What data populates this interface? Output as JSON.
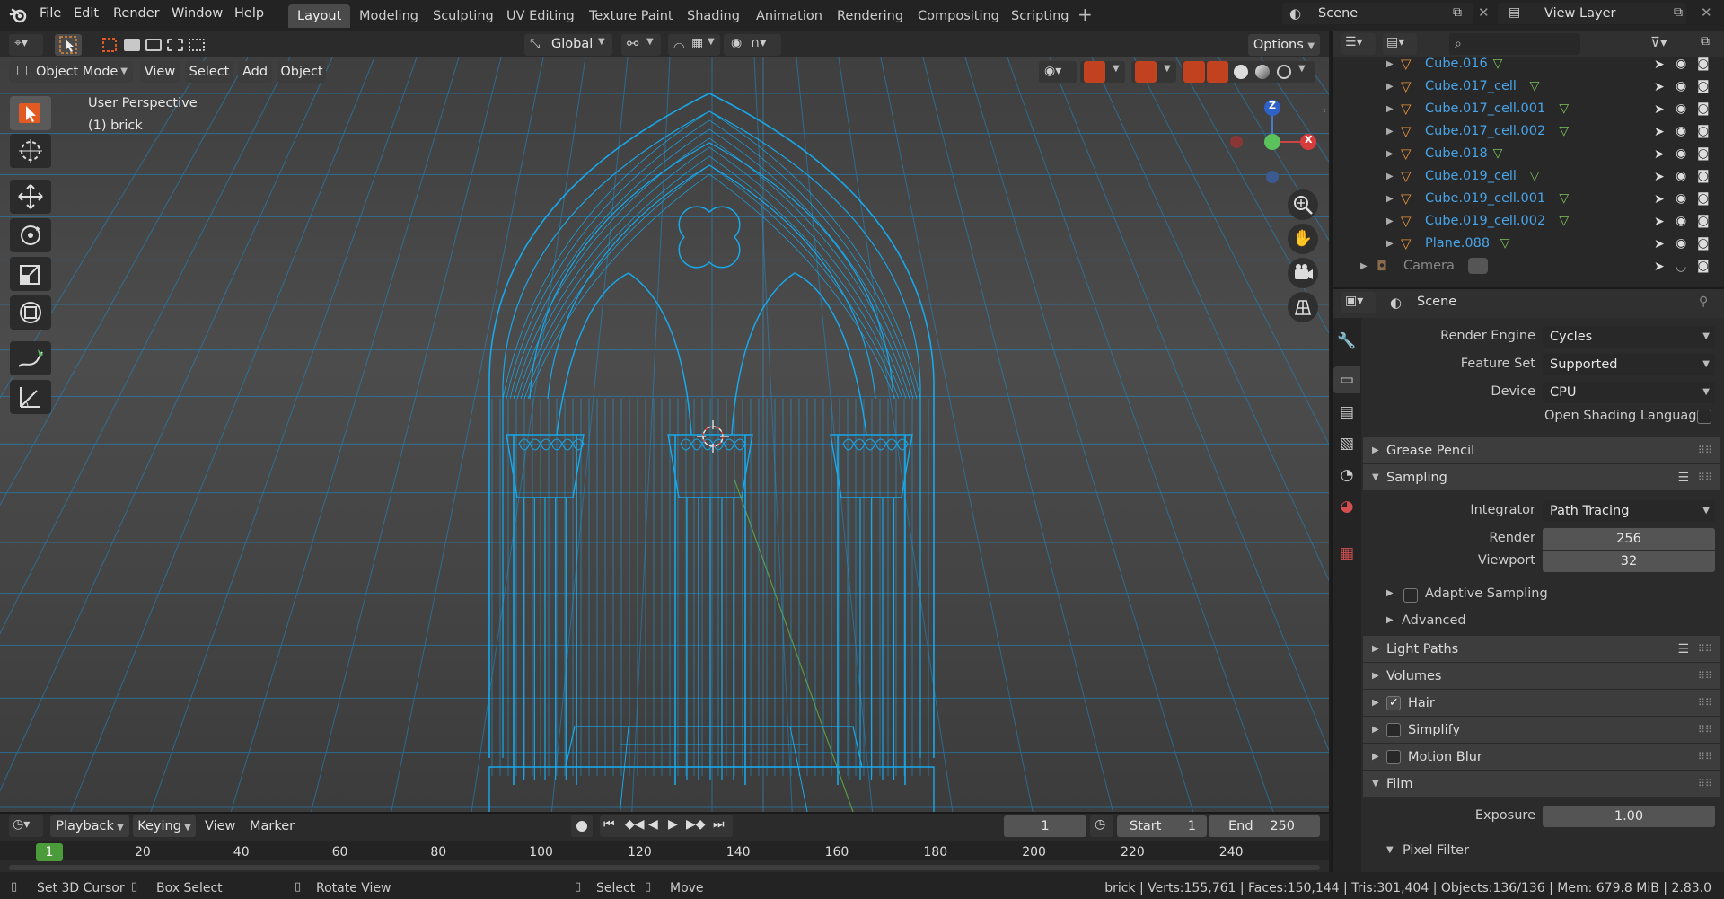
{
  "topbar": {
    "menus": [
      "File",
      "Edit",
      "Render",
      "Window",
      "Help"
    ],
    "workspaces": [
      "Layout",
      "Modeling",
      "Sculpting",
      "UV Editing",
      "Texture Paint",
      "Shading",
      "Animation",
      "Rendering",
      "Compositing",
      "Scripting"
    ],
    "active_workspace": "Layout",
    "add_tab": "+",
    "scene_name": "Scene",
    "view_layer": "View Layer"
  },
  "tool_header": {
    "orientation": "Global",
    "options": "Options"
  },
  "viewport_header": {
    "mode": "Object Mode",
    "menus": [
      "View",
      "Select",
      "Add",
      "Object"
    ]
  },
  "viewport": {
    "view_name": "User Perspective",
    "object_name": "(1) brick",
    "gizmo": {
      "z": "Z",
      "x": "X"
    }
  },
  "outliner": {
    "rows": [
      {
        "name": "Cube.016"
      },
      {
        "name": "Cube.017_cell"
      },
      {
        "name": "Cube.017_cell.001"
      },
      {
        "name": "Cube.017_cell.002"
      },
      {
        "name": "Cube.018"
      },
      {
        "name": "Cube.019_cell"
      },
      {
        "name": "Cube.019_cell.001"
      },
      {
        "name": "Cube.019_cell.002"
      },
      {
        "name": "Plane.088"
      }
    ],
    "camera_row": "Camera"
  },
  "properties": {
    "context": "Scene",
    "render_engine_label": "Render Engine",
    "render_engine": "Cycles",
    "feature_set_label": "Feature Set",
    "feature_set": "Supported",
    "device_label": "Device",
    "device": "CPU",
    "osl_label": "Open Shading Language",
    "panels": {
      "grease_pencil": "Grease Pencil",
      "sampling": "Sampling",
      "light_paths": "Light Paths",
      "volumes": "Volumes",
      "hair": "Hair",
      "simplify": "Simplify",
      "motion_blur": "Motion Blur",
      "film": "Film"
    },
    "integrator_label": "Integrator",
    "integrator": "Path Tracing",
    "render_label": "Render",
    "render_samples": "256",
    "viewport_label": "Viewport",
    "viewport_samples": "32",
    "adaptive_sampling": "Adaptive Sampling",
    "advanced": "Advanced",
    "exposure_label": "Exposure",
    "exposure": "1.00",
    "pixel_filter": "Pixel Filter"
  },
  "timeline": {
    "menus": [
      "Playback",
      "Keying",
      "View",
      "Marker"
    ],
    "current_frame": "1",
    "start_label": "Start",
    "start": "1",
    "end_label": "End",
    "end": "250",
    "ruler": [
      "20",
      "40",
      "60",
      "80",
      "100",
      "120",
      "140",
      "160",
      "180",
      "200",
      "220",
      "240"
    ],
    "playhead": "1"
  },
  "statusbar": {
    "hint1": "Set 3D Cursor",
    "hint2": "Box Select",
    "hint3": "Rotate View",
    "hint4": "Select",
    "hint5": "Move",
    "stats": "brick | Verts:155,761 | Faces:150,144 | Tris:301,404 | Objects:136/136 | Mem: 679.8 MiB | 2.83.0"
  },
  "colors": {
    "accent": "#4772b3",
    "wire": "#1aa3e6",
    "active_tool": "#e05a22",
    "outliner_text": "#48a3e7"
  }
}
